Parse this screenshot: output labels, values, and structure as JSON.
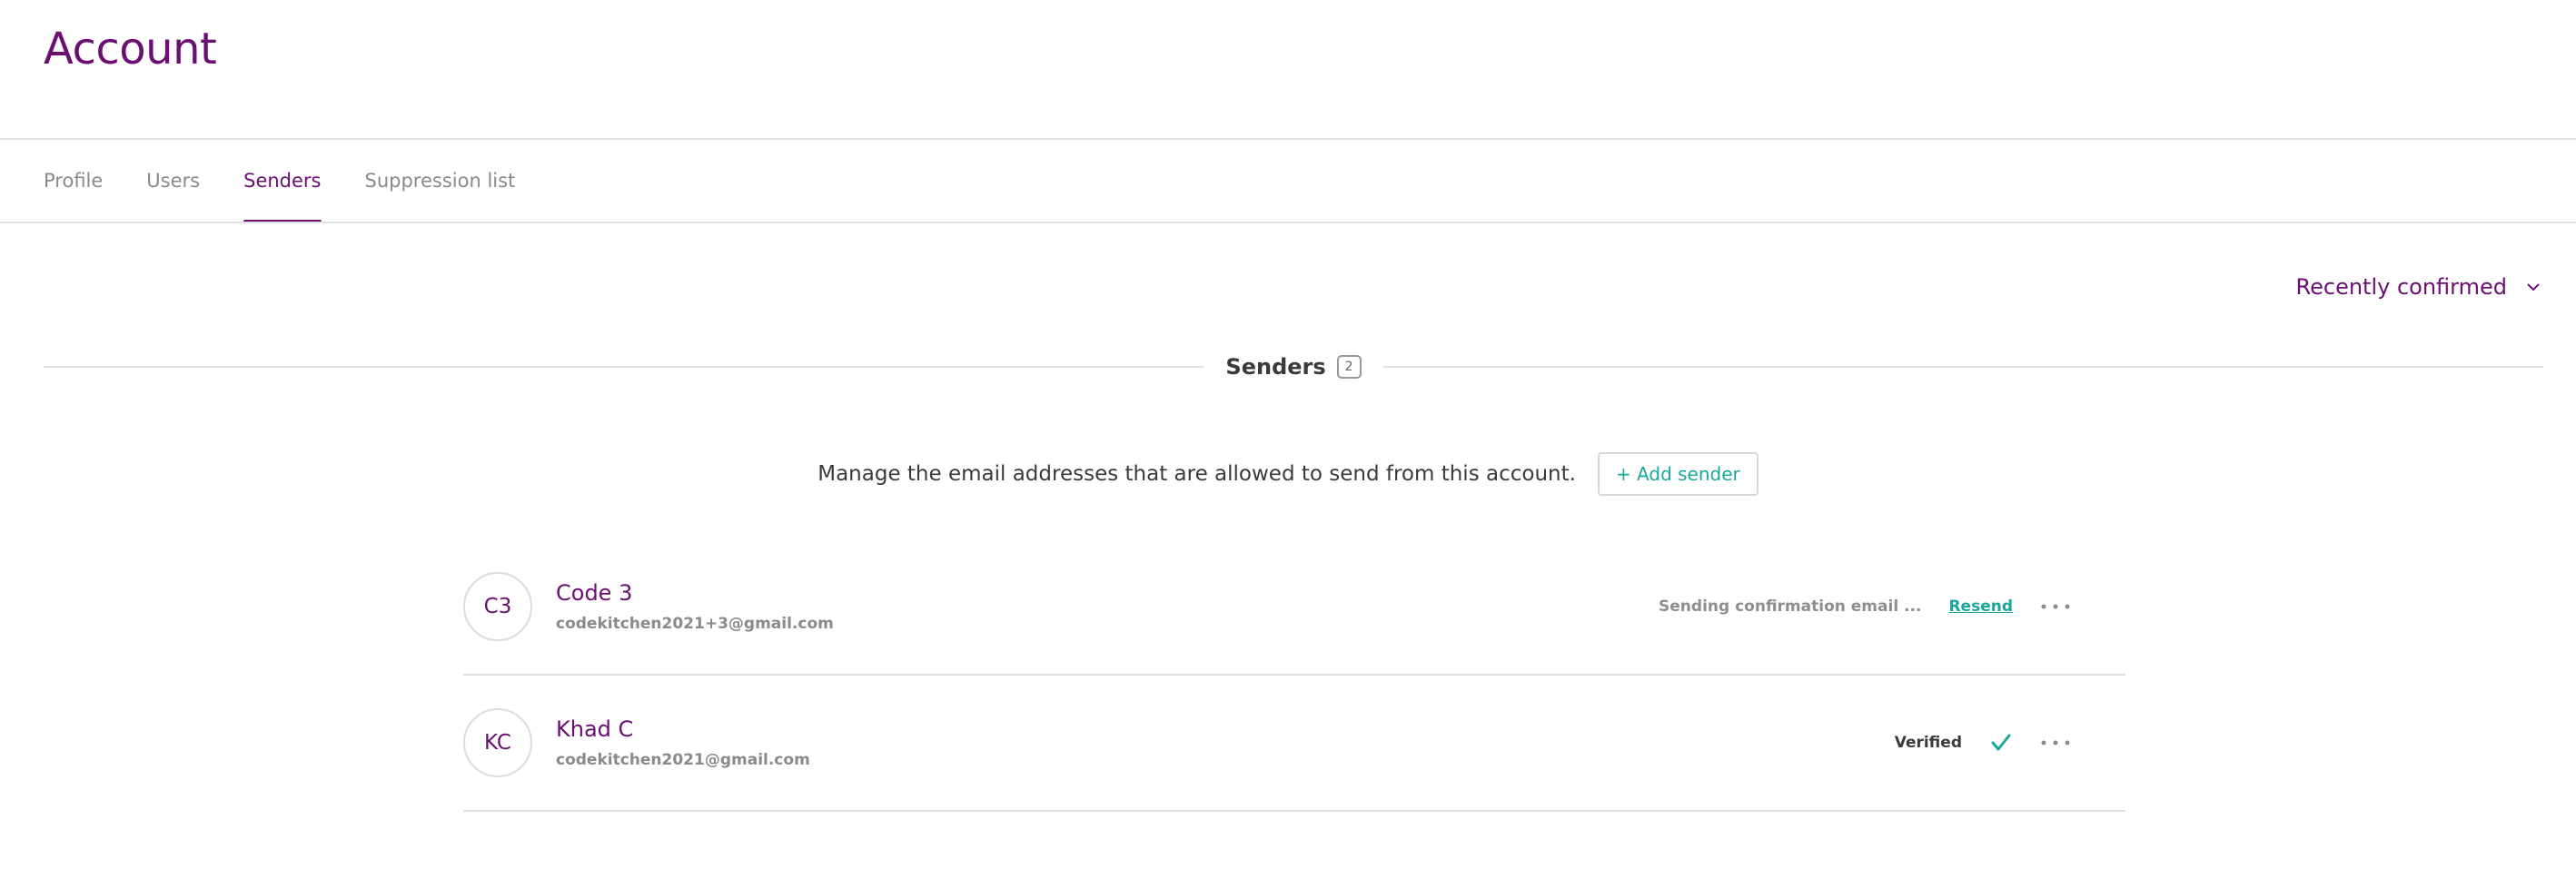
{
  "page": {
    "title": "Account"
  },
  "tabs": [
    {
      "label": "Profile",
      "active": false
    },
    {
      "label": "Users",
      "active": false
    },
    {
      "label": "Senders",
      "active": true
    },
    {
      "label": "Suppression list",
      "active": false
    }
  ],
  "sort": {
    "label": "Recently confirmed",
    "icon": "chevron-down-icon"
  },
  "section": {
    "heading": "Senders",
    "count": "2"
  },
  "manage": {
    "text": "Manage the email addresses that are allowed to send from this account.",
    "add_button": "+ Add sender"
  },
  "senders": [
    {
      "initials": "C3",
      "name": "Code 3",
      "email": "codekitchen2021+3@gmail.com",
      "status": "Sending confirmation email ...",
      "action": "Resend",
      "more_icon": "more-horizontal-icon"
    },
    {
      "initials": "KC",
      "name": "Khad C",
      "email": "codekitchen2021@gmail.com",
      "status": "Verified",
      "status_icon": "check-icon",
      "more_icon": "more-horizontal-icon"
    }
  ],
  "colors": {
    "brand": "#6b0f73",
    "accent": "#1aa89d",
    "divider": "#e2e2e2"
  }
}
